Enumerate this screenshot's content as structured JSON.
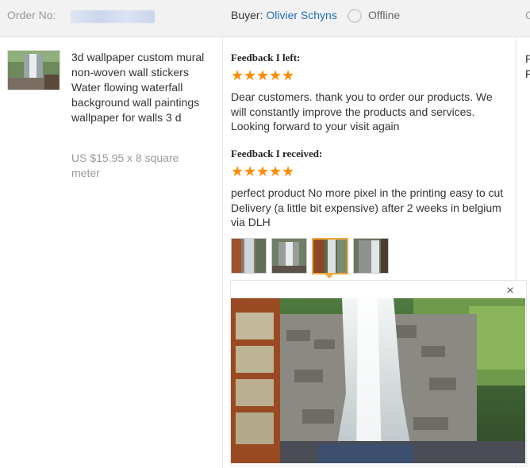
{
  "header": {
    "order_label": "Order No:",
    "buyer_label": "Buyer:",
    "buyer_name": "Olivier Schyns",
    "status": "Offline",
    "cut_column_label": "C"
  },
  "product": {
    "title": "3d wallpaper custom mural non-woven wall stickers Water flowing waterfall background wall paintings wallpaper for walls 3 d",
    "price": "US $15.95 x 8 square meter"
  },
  "feedback_left": {
    "heading": "Feedback I left:",
    "stars": 5,
    "text": "Dear customers. thank you to order our products. We will constantly improve the products and services. Looking forward to your visit again"
  },
  "feedback_received": {
    "heading": "Feedback I received:",
    "stars": 5,
    "text": "perfect product No more pixel in the printing easy to cut Delivery (a little bit expensive) after 2 weeks in belgium via DLH",
    "selected_photo_index": 2,
    "photo_count": 4
  },
  "right_column": {
    "line1": "P",
    "line2": "F"
  },
  "icons": {
    "star": "star-icon",
    "offline": "offline-status-icon",
    "close": "close-icon"
  },
  "colors": {
    "star": "#ff8a00",
    "link": "#1f6fb5",
    "selected_border": "#f0a93c"
  },
  "close_symbol": "×"
}
